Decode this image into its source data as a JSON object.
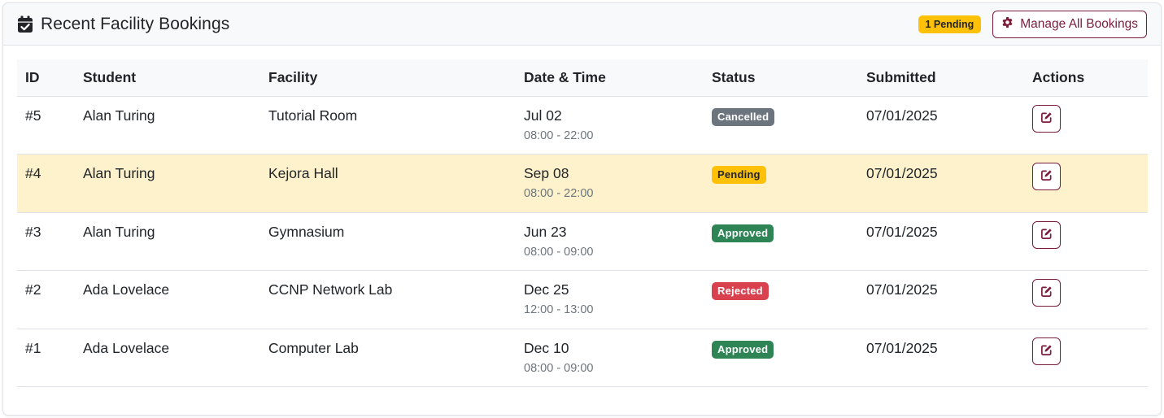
{
  "header": {
    "title": "Recent Facility Bookings",
    "pending_badge": "1 Pending",
    "manage_button": "Manage All Bookings"
  },
  "colors": {
    "accent": "#7b1c3b",
    "pending": "#ffc107",
    "approved": "#2e8454",
    "rejected": "#d9414f",
    "cancelled": "#6c757d",
    "highlight_row": "#fdf2cc"
  },
  "table": {
    "columns": [
      "ID",
      "Student",
      "Facility",
      "Date & Time",
      "Status",
      "Submitted",
      "Actions"
    ],
    "rows": [
      {
        "id": "#5",
        "student": "Alan Turing",
        "facility": "Tutorial Room",
        "date": "Jul 02",
        "time": "08:00 - 22:00",
        "status": "Cancelled",
        "status_color": "#6c757d",
        "submitted": "07/01/2025",
        "highlight": false
      },
      {
        "id": "#4",
        "student": "Alan Turing",
        "facility": "Kejora Hall",
        "date": "Sep 08",
        "time": "08:00 - 22:00",
        "status": "Pending",
        "status_color": "#ffc107",
        "submitted": "07/01/2025",
        "highlight": true
      },
      {
        "id": "#3",
        "student": "Alan Turing",
        "facility": "Gymnasium",
        "date": "Jun 23",
        "time": "08:00 - 09:00",
        "status": "Approved",
        "status_color": "#2e8454",
        "submitted": "07/01/2025",
        "highlight": false
      },
      {
        "id": "#2",
        "student": "Ada Lovelace",
        "facility": "CCNP Network Lab",
        "date": "Dec 25",
        "time": "12:00 - 13:00",
        "status": "Rejected",
        "status_color": "#d9414f",
        "submitted": "07/01/2025",
        "highlight": false
      },
      {
        "id": "#1",
        "student": "Ada Lovelace",
        "facility": "Computer Lab",
        "date": "Dec 10",
        "time": "08:00 - 09:00",
        "status": "Approved",
        "status_color": "#2e8454",
        "submitted": "07/01/2025",
        "highlight": false
      }
    ]
  },
  "icons": {
    "title": "calendar-check-icon",
    "manage": "gear-icon",
    "row_action": "edit-icon"
  }
}
